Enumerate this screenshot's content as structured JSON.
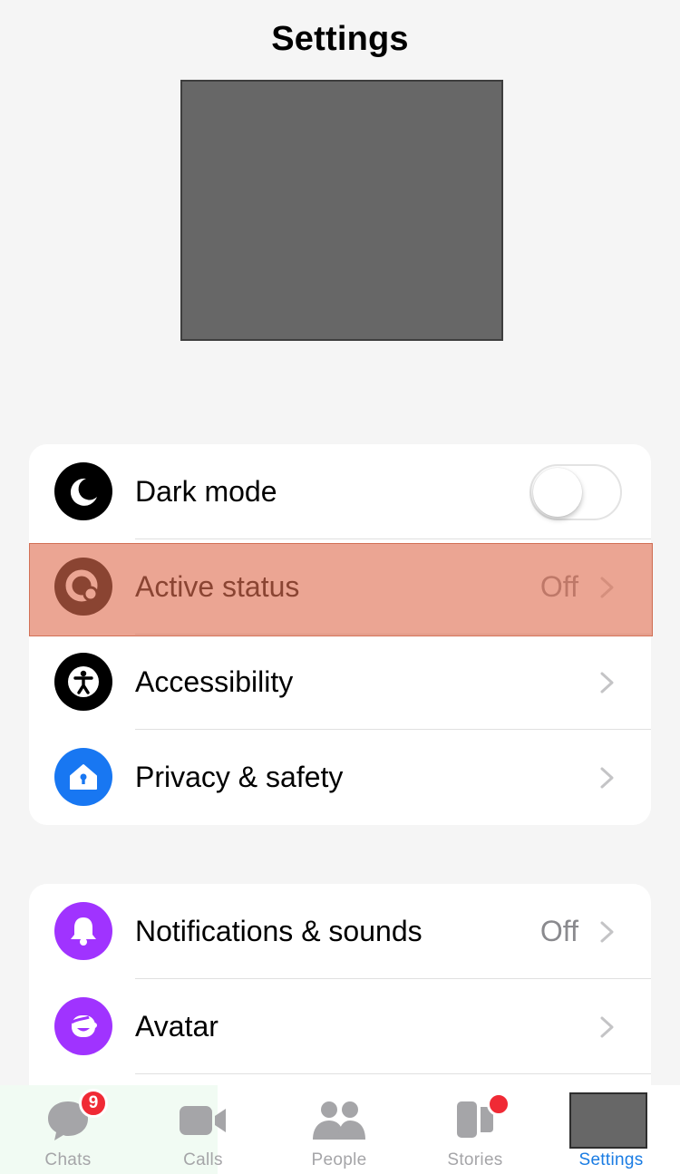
{
  "header": {
    "title": "Settings"
  },
  "settings_group_1": {
    "dark_mode": {
      "label": "Dark mode",
      "enabled": false
    },
    "active_status": {
      "label": "Active status",
      "value": "Off"
    },
    "accessibility": {
      "label": "Accessibility"
    },
    "privacy_safety": {
      "label": "Privacy & safety"
    }
  },
  "settings_group_2": {
    "notifications": {
      "label": "Notifications & sounds",
      "value": "Off"
    },
    "avatar": {
      "label": "Avatar"
    }
  },
  "tabbar": {
    "chats": {
      "label": "Chats",
      "badge": "9"
    },
    "calls": {
      "label": "Calls"
    },
    "people": {
      "label": "People"
    },
    "stories": {
      "label": "Stories"
    },
    "settings": {
      "label": "Settings"
    }
  },
  "colors": {
    "accent": "#1a7ce3",
    "badge": "#f02a35",
    "highlight": "#de6e50",
    "icon_black": "#000000",
    "icon_blue": "#1877f2",
    "icon_purple": "#a033ff",
    "tab_inactive": "#a5a5a8"
  }
}
